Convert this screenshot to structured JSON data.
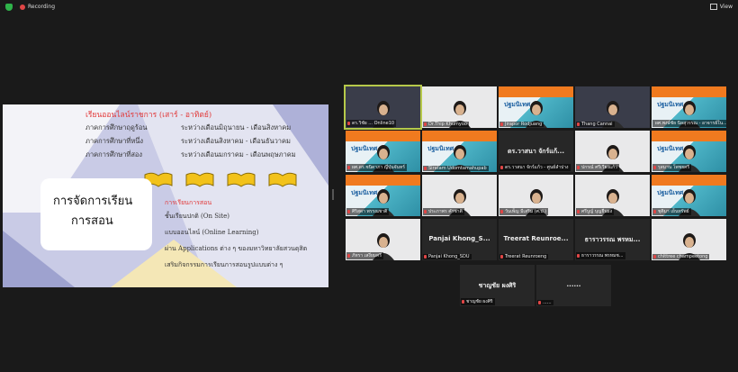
{
  "topbar": {
    "recording_label": "Recording",
    "view_label": "View"
  },
  "slide": {
    "header": "เรียนออนไลน์ราชการ (เสาร์ - อาทิตย์)",
    "rows": [
      {
        "term": "ภาคการศึกษาฤดูร้อน",
        "period": "ระหว่างเดือนมิถุนายน - เดือนสิงหาคม"
      },
      {
        "term": "ภาคการศึกษาที่หนึ่ง",
        "period": "ระหว่างเดือนสิงหาคม - เดือนธันวาคม"
      },
      {
        "term": "ภาคการศึกษาที่สอง",
        "period": "ระหว่างเดือนมกราคม - เดือนพฤษภาคม"
      }
    ],
    "title_line1": "การจัดการเรียน",
    "title_line2": "การสอน",
    "subheader": "การเรียนการสอน",
    "methods": [
      "ชั้นเรียนปกติ (On Site)",
      "แบบออนไลน์ (Online Learning)",
      "ผ่าน Applications ต่าง ๆ ของมหาวิทยาลัยสวนดุสิต",
      "เสริมกิจกรรมการเรียนการสอนรูปแบบต่าง ๆ"
    ]
  },
  "gallery": {
    "tiles": [
      {
        "name": "ดร.วิชัย ... Online10",
        "kind": "room"
      },
      {
        "name": "Dr.Thip Khumyoo",
        "kind": "person"
      },
      {
        "name": "Jirapor Rodjuang",
        "kind": "poster"
      },
      {
        "name": "Thang Cannai",
        "kind": "room"
      },
      {
        "name": "ผศ.พงษ์ชัย นิลสุวรรณ - อาจารย์ใน...",
        "kind": "poster"
      },
      {
        "name": "ผศ.ดร.ชนิดาภา ญี่ปุ่นจันทร์",
        "kind": "poster"
      },
      {
        "name": "Siratam Udomtamahupab",
        "kind": "poster"
      },
      {
        "name": "ดร.วาสนา จักร์แก้ว - ศูนย์ลำปาง",
        "kind": "text",
        "big": "ดร.วาสนา จักร์แก้..."
      },
      {
        "name": "ปกรณ์ ศรีเวียงแก้ว",
        "kind": "person"
      },
      {
        "name": "รุสมาน โพชยศรี",
        "kind": "poster"
      },
      {
        "name": "ศิริสุดา พรรณชาติ",
        "kind": "poster"
      },
      {
        "name": "ประภาพร คำชาติ",
        "kind": "person"
      },
      {
        "name": "วันเพ็ญ มีเสริม (ศ.ป.)",
        "kind": "person"
      },
      {
        "name": "ศรีบูญ์ บุญยืนยง",
        "kind": "person"
      },
      {
        "name": "ชุติมา เย็นทรัพย์",
        "kind": "poster"
      },
      {
        "name": "ภัทรา เสงี่ยมศรี",
        "kind": "person"
      },
      {
        "name": "Panjai Khong_SDU",
        "kind": "text",
        "big": "Panjai  Khong_S..."
      },
      {
        "name": "Treerat Reunroeng",
        "kind": "text",
        "big": "Treerat  Reunroe..."
      },
      {
        "name": "ธาราวรรณ พรหมช...",
        "kind": "text",
        "big": "ธาราวรรณ  พรหม..."
      },
      {
        "name": "chittree champeetong",
        "kind": "person"
      },
      {
        "name": "ชาญชัย ผงศิริ",
        "kind": "text",
        "big": "ชาญชัย  ผงศิริ"
      },
      {
        "name": "......",
        "kind": "text",
        "big": "......"
      }
    ]
  },
  "colors": {
    "accent_active": "#b6c94a",
    "poster_orange": "#f07a1f",
    "poster_teal": "#2e8fa5",
    "slide_header": "#e23a3a"
  }
}
